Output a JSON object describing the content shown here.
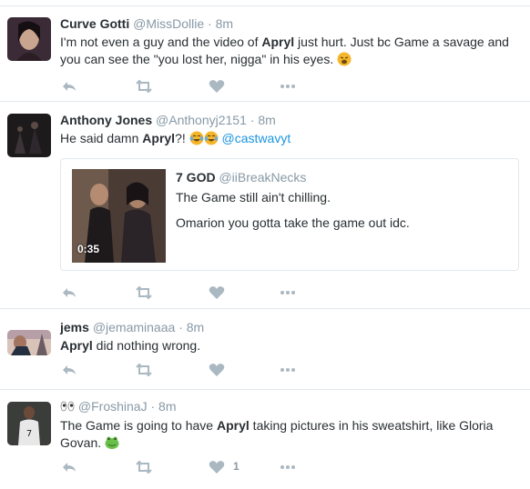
{
  "tweets": [
    {
      "name": "Curve Gotti",
      "handle": "@MissDollie",
      "sep": "·",
      "time": "8m",
      "text_1": "I'm not even a guy and the video of ",
      "bold_1": "Apryl",
      "text_2": " just hurt. Just bc Game a savage and you can see the \"you lost her, nigga\" in his eyes."
    },
    {
      "name": "Anthony Jones",
      "handle": "@Anthonyj2151",
      "sep": "·",
      "time": "8m",
      "text_1": "He said damn ",
      "bold_1": "Apryl",
      "text_2": "?! ",
      "mention": "@castwavyt",
      "quote": {
        "name": "7 GOD",
        "handle": "@iiBreakNecks",
        "line_1": "The Game still ain't chilling.",
        "line_2": "Omarion you gotta take the game out idc.",
        "duration": "0:35"
      }
    },
    {
      "name": "jems",
      "handle": "@jemaminaaa",
      "sep": "·",
      "time": "8m",
      "bold_1": "Apryl",
      "text_2": " did nothing wrong."
    },
    {
      "name": "",
      "handle": "@FroshinaJ",
      "sep": "·",
      "time": "8m",
      "text_1": "The Game is going to have ",
      "bold_1": "Apryl",
      "text_2": " taking pictures in his sweatshirt, like Gloria Govan.",
      "like_count": "1"
    }
  ],
  "icons": [
    "reply-icon",
    "retweet-icon",
    "like-icon",
    "more-icon"
  ],
  "colors": {
    "mention": "#1b95e0",
    "meta": "#8899a6",
    "icon": "#aab8c2",
    "border": "#e1e8ed"
  }
}
